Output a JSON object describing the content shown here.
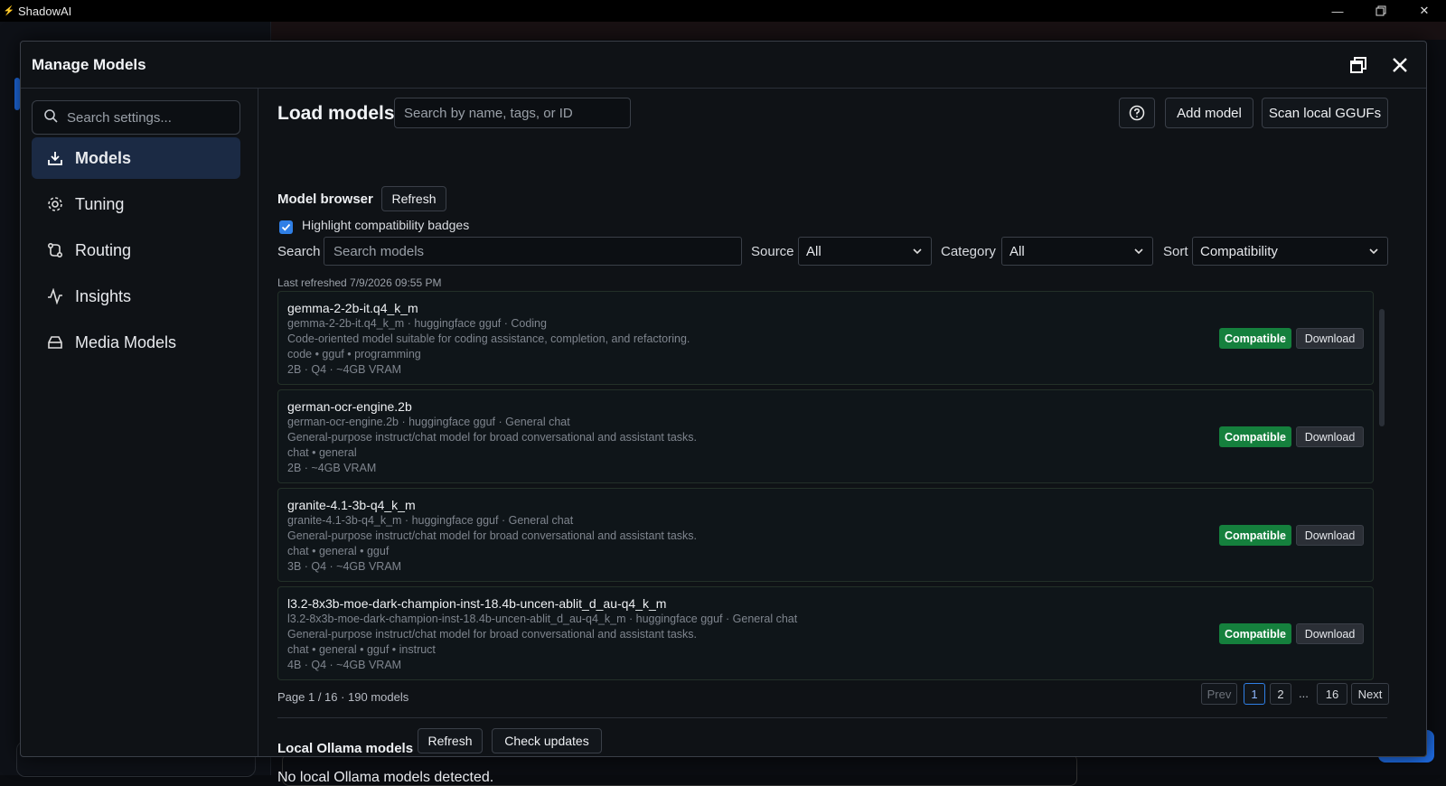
{
  "window": {
    "title": "ShadowAI"
  },
  "modal": {
    "title": "Manage Models"
  },
  "nav": {
    "search_placeholder": "Search settings...",
    "items": [
      {
        "label": "Models",
        "icon": "download-icon",
        "active": true
      },
      {
        "label": "Tuning",
        "icon": "gear-icon"
      },
      {
        "label": "Routing",
        "icon": "routing-icon"
      },
      {
        "label": "Insights",
        "icon": "activity-icon"
      },
      {
        "label": "Media Models",
        "icon": "drive-icon"
      }
    ]
  },
  "content": {
    "title": "Load models",
    "search_placeholder": "Search by name, tags, or ID",
    "add_model": "Add model",
    "scan_local": "Scan local GGUFs",
    "browser": {
      "label": "Model browser",
      "refresh": "Refresh",
      "highlight_label": "Highlight compatibility badges",
      "highlight_checked": true,
      "search_label": "Search",
      "search_placeholder": "Search models",
      "source_label": "Source",
      "source_value": "All",
      "category_label": "Category",
      "category_value": "All",
      "sort_label": "Sort",
      "sort_value": "Compatibility",
      "last_refreshed": "Last refreshed 7/9/2026 09:55 PM"
    },
    "models": [
      {
        "name": "gemma-2-2b-it.q4_k_m",
        "meta": "gemma-2-2b-it.q4_k_m · huggingface gguf · Coding",
        "desc": "Code-oriented model suitable for coding assistance, completion, and refactoring.",
        "tags": "code • gguf • programming",
        "specs": "2B · Q4 · ~4GB VRAM",
        "badge": "Compatible",
        "action": "Download"
      },
      {
        "name": "german-ocr-engine.2b",
        "meta": "german-ocr-engine.2b · huggingface gguf · General chat",
        "desc": "General-purpose instruct/chat model for broad conversational and assistant tasks.",
        "tags": "chat • general",
        "specs": "2B · ~4GB VRAM",
        "badge": "Compatible",
        "action": "Download"
      },
      {
        "name": "granite-4.1-3b-q4_k_m",
        "meta": "granite-4.1-3b-q4_k_m · huggingface gguf · General chat",
        "desc": "General-purpose instruct/chat model for broad conversational and assistant tasks.",
        "tags": "chat • general • gguf",
        "specs": "3B · Q4 · ~4GB VRAM",
        "badge": "Compatible",
        "action": "Download"
      },
      {
        "name": "l3.2-8x3b-moe-dark-champion-inst-18.4b-uncen-ablit_d_au-q4_k_m",
        "meta": "l3.2-8x3b-moe-dark-champion-inst-18.4b-uncen-ablit_d_au-q4_k_m · huggingface gguf · General chat",
        "desc": "General-purpose instruct/chat model for broad conversational and assistant tasks.",
        "tags": "chat • general • gguf • instruct",
        "specs": "4B · Q4 · ~4GB VRAM",
        "badge": "Compatible",
        "action": "Download"
      }
    ],
    "pagination": {
      "info": "Page 1 / 16 · 190 models",
      "prev": "Prev",
      "p1": "1",
      "p2": "2",
      "ellipsis": "...",
      "last": "16",
      "next": "Next"
    },
    "ollama": {
      "label": "Local Ollama models",
      "refresh": "Refresh",
      "check_updates": "Check updates",
      "empty": "No local Ollama models detected."
    }
  },
  "colors": {
    "accent": "#2f7fe6",
    "compatible": "#15803d",
    "active_nav": "#1b2a44"
  }
}
